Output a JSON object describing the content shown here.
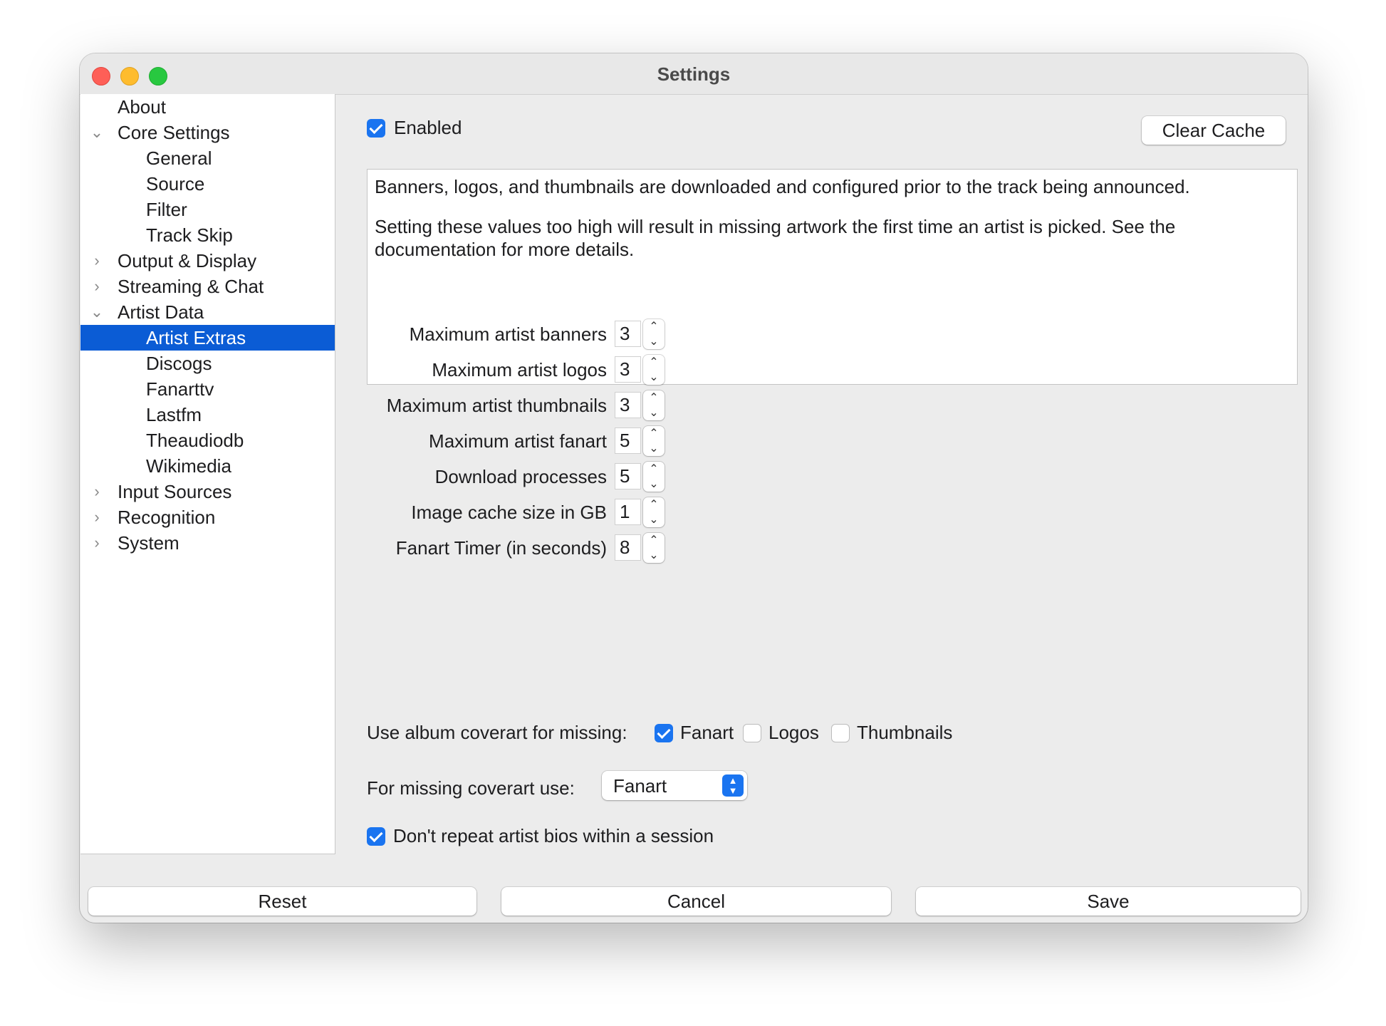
{
  "window": {
    "title": "Settings"
  },
  "sidebar": {
    "items": [
      {
        "label": "About",
        "level": 0,
        "arrow": ""
      },
      {
        "label": "Core Settings",
        "level": 0,
        "arrow": "expanded"
      },
      {
        "label": "General",
        "level": 1,
        "arrow": ""
      },
      {
        "label": "Source",
        "level": 1,
        "arrow": ""
      },
      {
        "label": "Filter",
        "level": 1,
        "arrow": ""
      },
      {
        "label": "Track Skip",
        "level": 1,
        "arrow": ""
      },
      {
        "label": "Output & Display",
        "level": 0,
        "arrow": "collapsed"
      },
      {
        "label": "Streaming & Chat",
        "level": 0,
        "arrow": "collapsed"
      },
      {
        "label": "Artist Data",
        "level": 0,
        "arrow": "expanded"
      },
      {
        "label": "Artist Extras",
        "level": 1,
        "arrow": "",
        "selected": true
      },
      {
        "label": "Discogs",
        "level": 1,
        "arrow": ""
      },
      {
        "label": "Fanarttv",
        "level": 1,
        "arrow": ""
      },
      {
        "label": "Lastfm",
        "level": 1,
        "arrow": ""
      },
      {
        "label": "Theaudiodb",
        "level": 1,
        "arrow": ""
      },
      {
        "label": "Wikimedia",
        "level": 1,
        "arrow": ""
      },
      {
        "label": "Input Sources",
        "level": 0,
        "arrow": "collapsed"
      },
      {
        "label": "Recognition",
        "level": 0,
        "arrow": "collapsed"
      },
      {
        "label": "System",
        "level": 0,
        "arrow": "collapsed"
      }
    ]
  },
  "main": {
    "enabled": {
      "label": "Enabled",
      "checked": true
    },
    "clear_cache_label": "Clear Cache",
    "description": [
      "Banners, logos, and thumbnails are downloaded and configured prior to the track being announced.",
      "Setting these values too high will result in missing artwork the first time an artist is picked. See the documentation for more details."
    ],
    "fields": [
      {
        "label": "Maximum artist banners",
        "value": "3"
      },
      {
        "label": "Maximum artist logos",
        "value": "3"
      },
      {
        "label": "Maximum artist thumbnails",
        "value": "3"
      },
      {
        "label": "Maximum artist fanart",
        "value": "5"
      },
      {
        "label": "Download processes",
        "value": "5"
      },
      {
        "label": "Image cache size in GB",
        "value": "1"
      },
      {
        "label": "Fanart Timer (in seconds)",
        "value": "8"
      }
    ],
    "coverart": {
      "label": "Use album coverart for missing:",
      "options": [
        {
          "label": "Fanart",
          "checked": true
        },
        {
          "label": "Logos",
          "checked": false
        },
        {
          "label": "Thumbnails",
          "checked": false
        }
      ]
    },
    "missing_coverart": {
      "label": "For missing coverart use:",
      "selected": "Fanart"
    },
    "dont_repeat": {
      "label": "Don't repeat artist bios within a session",
      "checked": true
    }
  },
  "footer": {
    "reset": "Reset",
    "cancel": "Cancel",
    "save": "Save"
  }
}
